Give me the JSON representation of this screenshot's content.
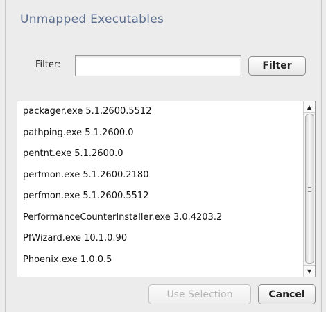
{
  "dialog": {
    "title": "Unmapped Executables"
  },
  "filter": {
    "label": "Filter:",
    "input_value": "",
    "button_label": "Filter"
  },
  "list": {
    "items": [
      "packager.exe 5.1.2600.5512",
      "pathping.exe 5.1.2600.0",
      "pentnt.exe 5.1.2600.0",
      "perfmon.exe 5.1.2600.2180",
      "perfmon.exe 5.1.2600.5512",
      "PerformanceCounterInstaller.exe 3.0.4203.2",
      "PfWizard.exe 10.1.0.90",
      "Phoenix.exe 1.0.0.5"
    ],
    "scroll_fraction": 0.9
  },
  "buttons": {
    "use_selection": "Use Selection",
    "cancel": "Cancel"
  },
  "icons": {
    "scroll_up": "triangle-up-icon",
    "scroll_down": "triangle-down-icon",
    "thumb_grip": "grip-icon"
  }
}
